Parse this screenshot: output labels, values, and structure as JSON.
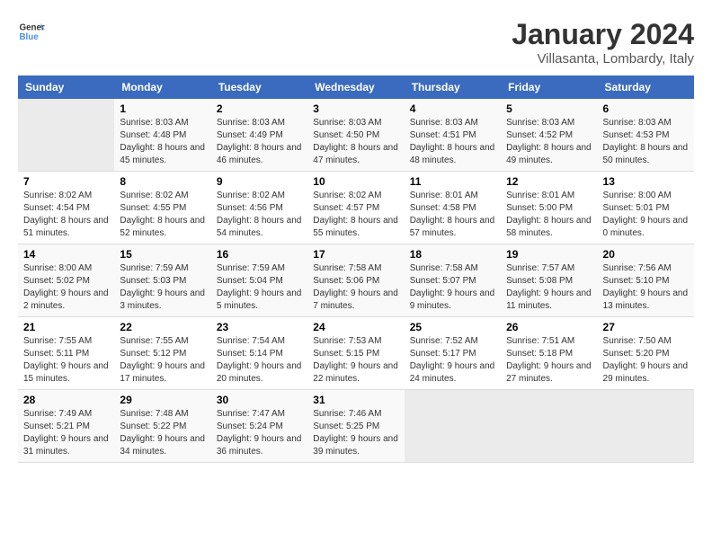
{
  "logo": {
    "line1": "General",
    "line2": "Blue"
  },
  "header": {
    "title": "January 2024",
    "subtitle": "Villasanta, Lombardy, Italy"
  },
  "days_of_week": [
    "Sunday",
    "Monday",
    "Tuesday",
    "Wednesday",
    "Thursday",
    "Friday",
    "Saturday"
  ],
  "weeks": [
    [
      {
        "day": "",
        "sunrise": "",
        "sunset": "",
        "daylight": ""
      },
      {
        "day": "1",
        "sunrise": "Sunrise: 8:03 AM",
        "sunset": "Sunset: 4:48 PM",
        "daylight": "Daylight: 8 hours and 45 minutes."
      },
      {
        "day": "2",
        "sunrise": "Sunrise: 8:03 AM",
        "sunset": "Sunset: 4:49 PM",
        "daylight": "Daylight: 8 hours and 46 minutes."
      },
      {
        "day": "3",
        "sunrise": "Sunrise: 8:03 AM",
        "sunset": "Sunset: 4:50 PM",
        "daylight": "Daylight: 8 hours and 47 minutes."
      },
      {
        "day": "4",
        "sunrise": "Sunrise: 8:03 AM",
        "sunset": "Sunset: 4:51 PM",
        "daylight": "Daylight: 8 hours and 48 minutes."
      },
      {
        "day": "5",
        "sunrise": "Sunrise: 8:03 AM",
        "sunset": "Sunset: 4:52 PM",
        "daylight": "Daylight: 8 hours and 49 minutes."
      },
      {
        "day": "6",
        "sunrise": "Sunrise: 8:03 AM",
        "sunset": "Sunset: 4:53 PM",
        "daylight": "Daylight: 8 hours and 50 minutes."
      }
    ],
    [
      {
        "day": "7",
        "sunrise": "Sunrise: 8:02 AM",
        "sunset": "Sunset: 4:54 PM",
        "daylight": "Daylight: 8 hours and 51 minutes."
      },
      {
        "day": "8",
        "sunrise": "Sunrise: 8:02 AM",
        "sunset": "Sunset: 4:55 PM",
        "daylight": "Daylight: 8 hours and 52 minutes."
      },
      {
        "day": "9",
        "sunrise": "Sunrise: 8:02 AM",
        "sunset": "Sunset: 4:56 PM",
        "daylight": "Daylight: 8 hours and 54 minutes."
      },
      {
        "day": "10",
        "sunrise": "Sunrise: 8:02 AM",
        "sunset": "Sunset: 4:57 PM",
        "daylight": "Daylight: 8 hours and 55 minutes."
      },
      {
        "day": "11",
        "sunrise": "Sunrise: 8:01 AM",
        "sunset": "Sunset: 4:58 PM",
        "daylight": "Daylight: 8 hours and 57 minutes."
      },
      {
        "day": "12",
        "sunrise": "Sunrise: 8:01 AM",
        "sunset": "Sunset: 5:00 PM",
        "daylight": "Daylight: 8 hours and 58 minutes."
      },
      {
        "day": "13",
        "sunrise": "Sunrise: 8:00 AM",
        "sunset": "Sunset: 5:01 PM",
        "daylight": "Daylight: 9 hours and 0 minutes."
      }
    ],
    [
      {
        "day": "14",
        "sunrise": "Sunrise: 8:00 AM",
        "sunset": "Sunset: 5:02 PM",
        "daylight": "Daylight: 9 hours and 2 minutes."
      },
      {
        "day": "15",
        "sunrise": "Sunrise: 7:59 AM",
        "sunset": "Sunset: 5:03 PM",
        "daylight": "Daylight: 9 hours and 3 minutes."
      },
      {
        "day": "16",
        "sunrise": "Sunrise: 7:59 AM",
        "sunset": "Sunset: 5:04 PM",
        "daylight": "Daylight: 9 hours and 5 minutes."
      },
      {
        "day": "17",
        "sunrise": "Sunrise: 7:58 AM",
        "sunset": "Sunset: 5:06 PM",
        "daylight": "Daylight: 9 hours and 7 minutes."
      },
      {
        "day": "18",
        "sunrise": "Sunrise: 7:58 AM",
        "sunset": "Sunset: 5:07 PM",
        "daylight": "Daylight: 9 hours and 9 minutes."
      },
      {
        "day": "19",
        "sunrise": "Sunrise: 7:57 AM",
        "sunset": "Sunset: 5:08 PM",
        "daylight": "Daylight: 9 hours and 11 minutes."
      },
      {
        "day": "20",
        "sunrise": "Sunrise: 7:56 AM",
        "sunset": "Sunset: 5:10 PM",
        "daylight": "Daylight: 9 hours and 13 minutes."
      }
    ],
    [
      {
        "day": "21",
        "sunrise": "Sunrise: 7:55 AM",
        "sunset": "Sunset: 5:11 PM",
        "daylight": "Daylight: 9 hours and 15 minutes."
      },
      {
        "day": "22",
        "sunrise": "Sunrise: 7:55 AM",
        "sunset": "Sunset: 5:12 PM",
        "daylight": "Daylight: 9 hours and 17 minutes."
      },
      {
        "day": "23",
        "sunrise": "Sunrise: 7:54 AM",
        "sunset": "Sunset: 5:14 PM",
        "daylight": "Daylight: 9 hours and 20 minutes."
      },
      {
        "day": "24",
        "sunrise": "Sunrise: 7:53 AM",
        "sunset": "Sunset: 5:15 PM",
        "daylight": "Daylight: 9 hours and 22 minutes."
      },
      {
        "day": "25",
        "sunrise": "Sunrise: 7:52 AM",
        "sunset": "Sunset: 5:17 PM",
        "daylight": "Daylight: 9 hours and 24 minutes."
      },
      {
        "day": "26",
        "sunrise": "Sunrise: 7:51 AM",
        "sunset": "Sunset: 5:18 PM",
        "daylight": "Daylight: 9 hours and 27 minutes."
      },
      {
        "day": "27",
        "sunrise": "Sunrise: 7:50 AM",
        "sunset": "Sunset: 5:20 PM",
        "daylight": "Daylight: 9 hours and 29 minutes."
      }
    ],
    [
      {
        "day": "28",
        "sunrise": "Sunrise: 7:49 AM",
        "sunset": "Sunset: 5:21 PM",
        "daylight": "Daylight: 9 hours and 31 minutes."
      },
      {
        "day": "29",
        "sunrise": "Sunrise: 7:48 AM",
        "sunset": "Sunset: 5:22 PM",
        "daylight": "Daylight: 9 hours and 34 minutes."
      },
      {
        "day": "30",
        "sunrise": "Sunrise: 7:47 AM",
        "sunset": "Sunset: 5:24 PM",
        "daylight": "Daylight: 9 hours and 36 minutes."
      },
      {
        "day": "31",
        "sunrise": "Sunrise: 7:46 AM",
        "sunset": "Sunset: 5:25 PM",
        "daylight": "Daylight: 9 hours and 39 minutes."
      },
      {
        "day": "",
        "sunrise": "",
        "sunset": "",
        "daylight": ""
      },
      {
        "day": "",
        "sunrise": "",
        "sunset": "",
        "daylight": ""
      },
      {
        "day": "",
        "sunrise": "",
        "sunset": "",
        "daylight": ""
      }
    ]
  ]
}
